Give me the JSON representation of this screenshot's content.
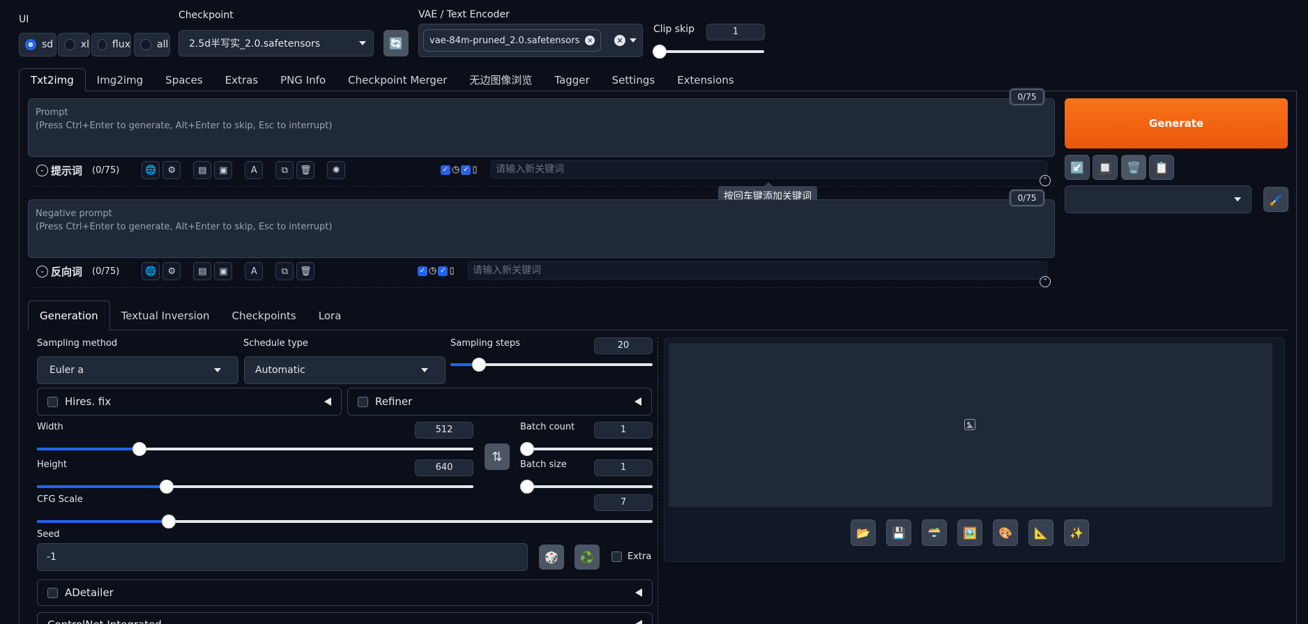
{
  "top": {
    "ui_label": "UI",
    "ui_options": [
      {
        "label": "sd",
        "selected": true
      },
      {
        "label": "xl",
        "selected": false
      },
      {
        "label": "flux",
        "selected": false
      },
      {
        "label": "all",
        "selected": false
      }
    ],
    "checkpoint_label": "Checkpoint",
    "checkpoint_value": "2.5d半写实_2.0.safetensors",
    "refresh_icon": "🔄",
    "vae_label": "VAE / Text Encoder",
    "vae_chip": "vae-84m-pruned_2.0.safetensors",
    "clip_skip_label": "Clip skip",
    "clip_skip_value": "1"
  },
  "main_tabs": [
    "Txt2img",
    "Img2img",
    "Spaces",
    "Extras",
    "PNG Info",
    "Checkpoint Merger",
    "无边图像浏览",
    "Tagger",
    "Settings",
    "Extensions"
  ],
  "prompt": {
    "placeholder_line1": "Prompt",
    "placeholder_line2": "(Press Ctrl+Enter to generate, Alt+Enter to skip, Esc to interrupt)",
    "counter": "0/75",
    "section_title": "提示词",
    "section_count": "(0/75)",
    "keyword_placeholder": "请输入新关键词"
  },
  "negative": {
    "placeholder_line1": "Negative prompt",
    "placeholder_line2": "(Press Ctrl+Enter to generate, Alt+Enter to skip, Esc to interrupt)",
    "counter": "0/75",
    "section_title": "反向词",
    "section_count": "(0/75)",
    "keyword_placeholder": "请输入新关键词"
  },
  "tooltip": "按回车键添加关键词",
  "generate_label": "Generate",
  "action_icons": [
    "↙️",
    "🔲",
    "🗑️",
    "📋"
  ],
  "styles_icon": "🖌️",
  "sub_tabs": [
    "Generation",
    "Textual Inversion",
    "Checkpoints",
    "Lora"
  ],
  "generation": {
    "sampling_method_label": "Sampling method",
    "sampling_method_value": "Euler a",
    "schedule_type_label": "Schedule type",
    "schedule_type_value": "Automatic",
    "sampling_steps_label": "Sampling steps",
    "sampling_steps_value": "20",
    "sampling_steps_fraction": 0.14,
    "hires_label": "Hires. fix",
    "refiner_label": "Refiner",
    "width_label": "Width",
    "width_value": "512",
    "width_fraction": 0.235,
    "height_label": "Height",
    "height_value": "640",
    "height_fraction": 0.297,
    "swap_icon": "⇅",
    "batch_count_label": "Batch count",
    "batch_count_value": "1",
    "batch_size_label": "Batch size",
    "batch_size_value": "1",
    "cfg_label": "CFG Scale",
    "cfg_value": "7",
    "cfg_fraction": 0.214,
    "seed_label": "Seed",
    "seed_value": "-1",
    "dice_icon": "🎲",
    "recycle_icon": "♻️",
    "extra_label": "Extra",
    "adetailer_label": "ADetailer",
    "controlnet_label": "ControlNet Integrated"
  },
  "output_icons": [
    "📂",
    "💾",
    "🗃️",
    "🖼️",
    "🎨",
    "📐",
    "✨"
  ]
}
